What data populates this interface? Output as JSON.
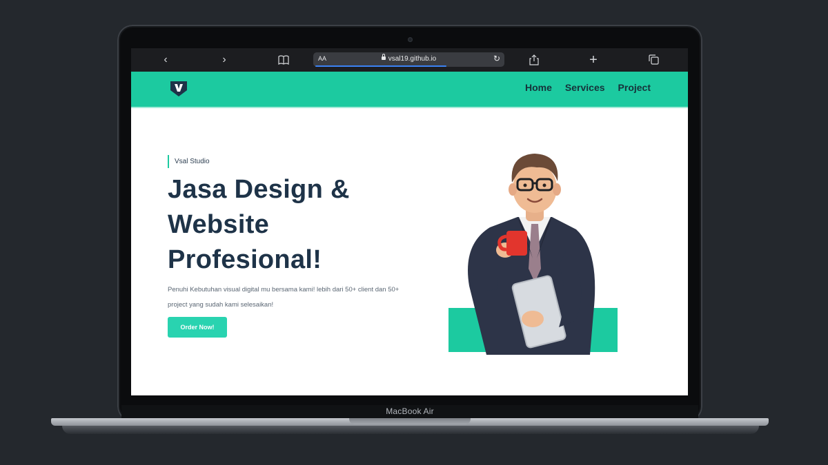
{
  "device": {
    "model_label": "MacBook Air"
  },
  "browser": {
    "text_size_label": "AA",
    "url": "vsal19.github.io",
    "icons": [
      "back-icon",
      "forward-icon",
      "bookmarks-icon",
      "lock-icon",
      "reload-icon",
      "share-icon",
      "new-tab-icon",
      "tabs-icon"
    ]
  },
  "site": {
    "colors": {
      "accent": "#1ccaa0",
      "heading": "#1e3348",
      "button": "#29d3b0"
    },
    "nav": {
      "items": [
        {
          "label": "Home"
        },
        {
          "label": "Services"
        },
        {
          "label": "Project"
        }
      ]
    },
    "hero": {
      "eyebrow": "Vsal Studio",
      "title_line1": "Jasa Design &",
      "title_line2": "Website",
      "title_line3": "Profesional!",
      "description": "Penuhi Kebutuhan visual digital mu bersama kami! lebih dari 50+ client dan 50+ project yang sudah kami selesaikan!",
      "cta_label": "Order Now!"
    }
  }
}
